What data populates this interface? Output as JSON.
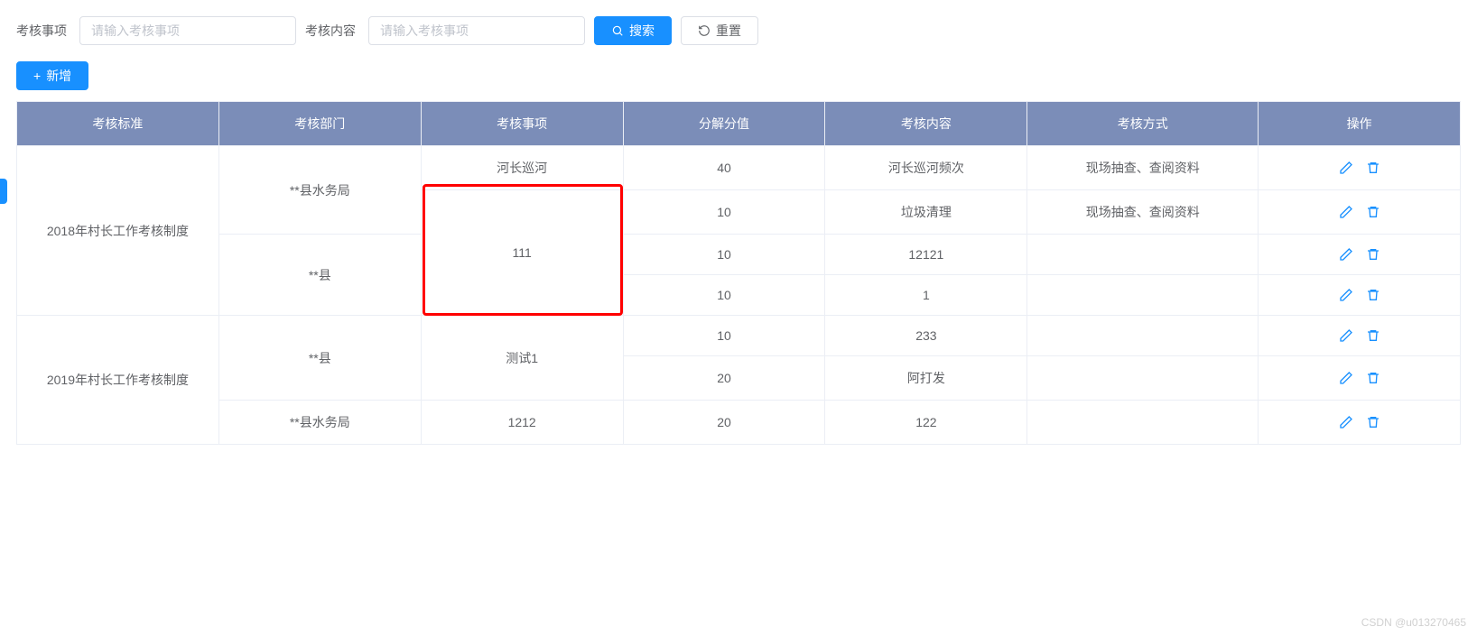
{
  "filter": {
    "label1": "考核事项",
    "placeholder1": "请输入考核事项",
    "label2": "考核内容",
    "placeholder2": "请输入考核事项",
    "search_label": "搜索",
    "reset_label": "重置"
  },
  "add_label": "新增",
  "columns": {
    "c0": "考核标准",
    "c1": "考核部门",
    "c2": "考核事项",
    "c3": "分解分值",
    "c4": "考核内容",
    "c5": "考核方式",
    "c6": "操作"
  },
  "cells": {
    "std_2018": "2018年村长工作考核制度",
    "std_2019": "2019年村长工作考核制度",
    "dept_water": "**县水务局",
    "dept_county": "**县",
    "item_river": "河长巡河",
    "item_111": "111",
    "item_test1": "测试1",
    "item_1212": "1212",
    "r1_score": "40",
    "r1_content": "河长巡河频次",
    "r1_method": "现场抽查、查阅资料",
    "r2_score": "10",
    "r2_content": "垃圾清理",
    "r2_method": "现场抽查、查阅资料",
    "r3_score": "10",
    "r3_content": "12121",
    "r3_method": "",
    "r4_score": "10",
    "r4_content": "1",
    "r4_method": "",
    "r5_score": "10",
    "r5_content": "233",
    "r5_method": "",
    "r6_score": "20",
    "r6_content": "阿打发",
    "r6_method": "",
    "r7_score": "20",
    "r7_content": "122",
    "r7_method": ""
  },
  "watermark": "CSDN @u013270465"
}
